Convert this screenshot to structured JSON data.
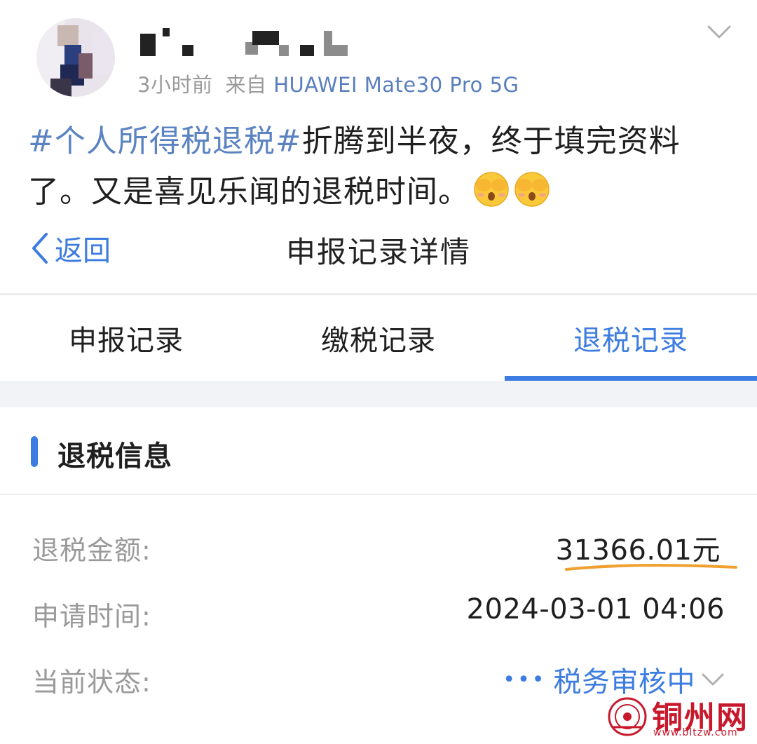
{
  "post": {
    "time": "3小时前",
    "source_prefix": "来自",
    "device": "HUAWEI Mate30 Pro 5G",
    "hashtag": "#个人所得税退税#",
    "text_line1": "折腾到半夜，终于填完资料",
    "text_line2": "了。又是喜见乐闻的退税时间。",
    "emojis": [
      "see-no-evil-face-emoji",
      "see-no-evil-face-emoji"
    ]
  },
  "nav": {
    "back_label": "返回",
    "title": "申报记录详情"
  },
  "tabs": [
    {
      "label": "申报记录",
      "active": false
    },
    {
      "label": "缴税记录",
      "active": false
    },
    {
      "label": "退税记录",
      "active": true
    }
  ],
  "section": {
    "title": "退税信息"
  },
  "fields": {
    "amount_label": "退税金额:",
    "amount_value": "31366.01元",
    "time_label": "申请时间:",
    "time_value": "2024-03-01 04:06",
    "status_label": "当前状态:",
    "status_dots": "•••",
    "status_value": "税务审核中"
  },
  "watermark": {
    "name": "铜州网",
    "url": "www.bltzw.com"
  },
  "colors": {
    "accent": "#3d7ce0",
    "hashtag": "#5b83c2",
    "underline": "#f0a030",
    "watermark": "#c8192c"
  }
}
